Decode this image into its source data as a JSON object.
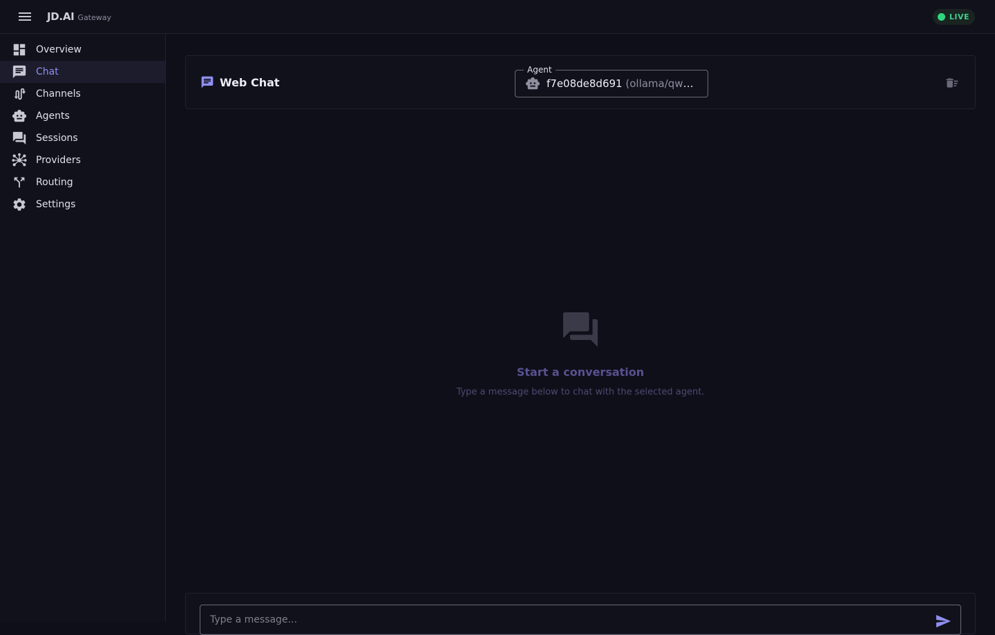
{
  "app": {
    "brand_main": "JD.AI",
    "brand_sub": "Gateway",
    "status": "LIVE"
  },
  "colors": {
    "accent": "#8f8ff0",
    "live": "#2fd67f",
    "background": "#0f0f1a",
    "panel": "#11111c"
  },
  "sidebar": {
    "items": [
      {
        "label": "Overview",
        "icon": "dashboard-icon"
      },
      {
        "label": "Chat",
        "icon": "chat-icon",
        "active": true
      },
      {
        "label": "Channels",
        "icon": "channels-icon"
      },
      {
        "label": "Agents",
        "icon": "robot-icon"
      },
      {
        "label": "Sessions",
        "icon": "forum-icon"
      },
      {
        "label": "Providers",
        "icon": "hub-icon"
      },
      {
        "label": "Routing",
        "icon": "fork-icon"
      },
      {
        "label": "Settings",
        "icon": "gear-icon"
      }
    ]
  },
  "chat": {
    "title": "Web Chat",
    "agent_label": "Agent",
    "agent_id": "f7e08de8d691",
    "agent_model": "(ollama/qwe…",
    "empty_title": "Start a conversation",
    "empty_sub": "Type a message below to chat with the selected agent.",
    "input_placeholder": "Type a message..."
  }
}
